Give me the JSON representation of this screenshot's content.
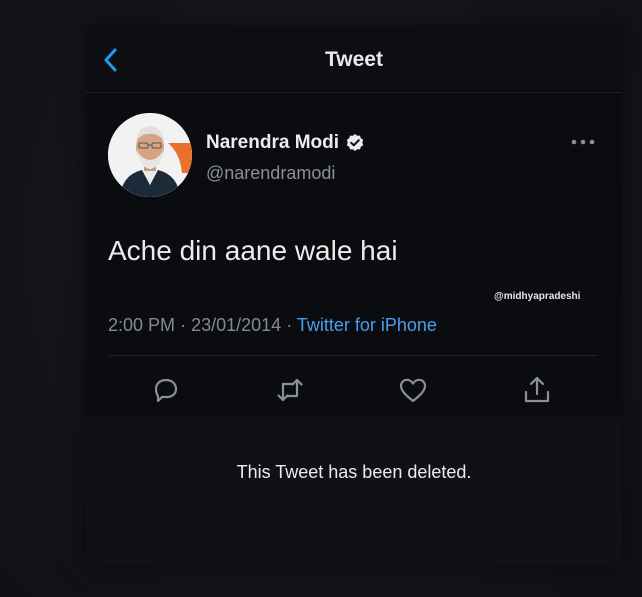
{
  "header": {
    "title": "Tweet",
    "back_icon": "chevron-left-icon"
  },
  "tweet": {
    "author": {
      "display_name": "Narendra Modi",
      "handle": "@narendramodi",
      "verified": true
    },
    "text": "Ache din aane wale hai",
    "time": "2:00 PM",
    "date": "23/01/2014",
    "separator": "·",
    "source": "Twitter for iPhone",
    "watermark": "@midhyapradeshi"
  },
  "actions": [
    {
      "name": "reply",
      "icon": "reply-icon"
    },
    {
      "name": "retweet",
      "icon": "retweet-icon"
    },
    {
      "name": "like",
      "icon": "heart-icon"
    },
    {
      "name": "share",
      "icon": "share-icon"
    }
  ],
  "deleted_notice": "This Tweet has been deleted.",
  "colors": {
    "accent": "#1d9bf0",
    "link": "#4a9fe8",
    "text_primary": "#ececed",
    "text_secondary": "#858a90",
    "background": "#0b0c0f"
  }
}
